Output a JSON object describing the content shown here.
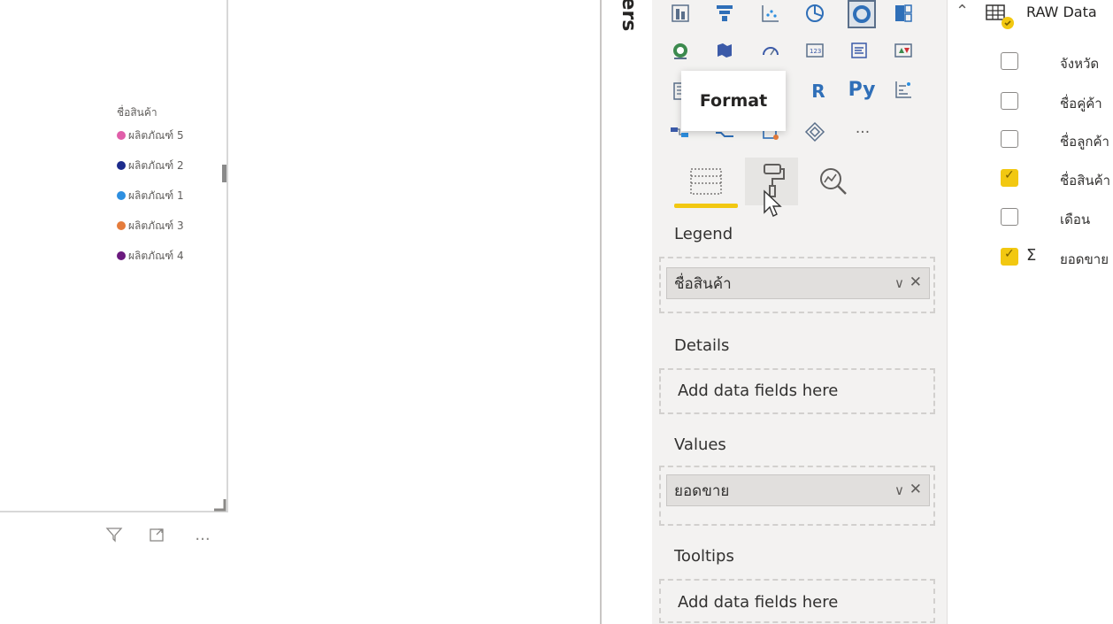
{
  "canvas": {
    "legend_title": "ชื่อสินค้า",
    "legend": [
      {
        "label": "ผลิตภัณฑ์ 5",
        "color": "#e05ea9"
      },
      {
        "label": "ผลิตภัณฑ์ 2",
        "color": "#1c2b8c"
      },
      {
        "label": "ผลิตภัณฑ์ 1",
        "color": "#2d8fe0"
      },
      {
        "label": "ผลิตภัณฑ์ 3",
        "color": "#e57c3c"
      },
      {
        "label": "ผลิตภัณฑ์ 4",
        "color": "#6b1a7e"
      }
    ],
    "tools": {
      "filter": "filter-icon",
      "focus": "focus-mode-icon",
      "more": "..."
    }
  },
  "filters_pane": {
    "label": "ters"
  },
  "viz_pane": {
    "tooltip": "Format",
    "gallery_text": {
      "r": "R",
      "py": "Py",
      "more": "..."
    },
    "wells": {
      "legend_label": "Legend",
      "legend_field": "ชื่อสินค้า",
      "details_label": "Details",
      "details_placeholder": "Add data fields here",
      "values_label": "Values",
      "values_field": "ยอดขาย",
      "tooltips_label": "Tooltips",
      "tooltips_placeholder": "Add data fields here"
    }
  },
  "fields_pane": {
    "table_name": "RAW Data",
    "fields": [
      {
        "name": "จังหวัด",
        "checked": false
      },
      {
        "name": "ชื่อคู่ค้า",
        "checked": false
      },
      {
        "name": "ชื่อลูกค้า",
        "checked": false
      },
      {
        "name": "ชื่อสินค้า",
        "checked": true
      },
      {
        "name": "เดือน",
        "checked": false
      },
      {
        "name": "ยอดขาย",
        "checked": true,
        "sigma": "Σ"
      }
    ]
  },
  "accent_color": "#f2c811"
}
